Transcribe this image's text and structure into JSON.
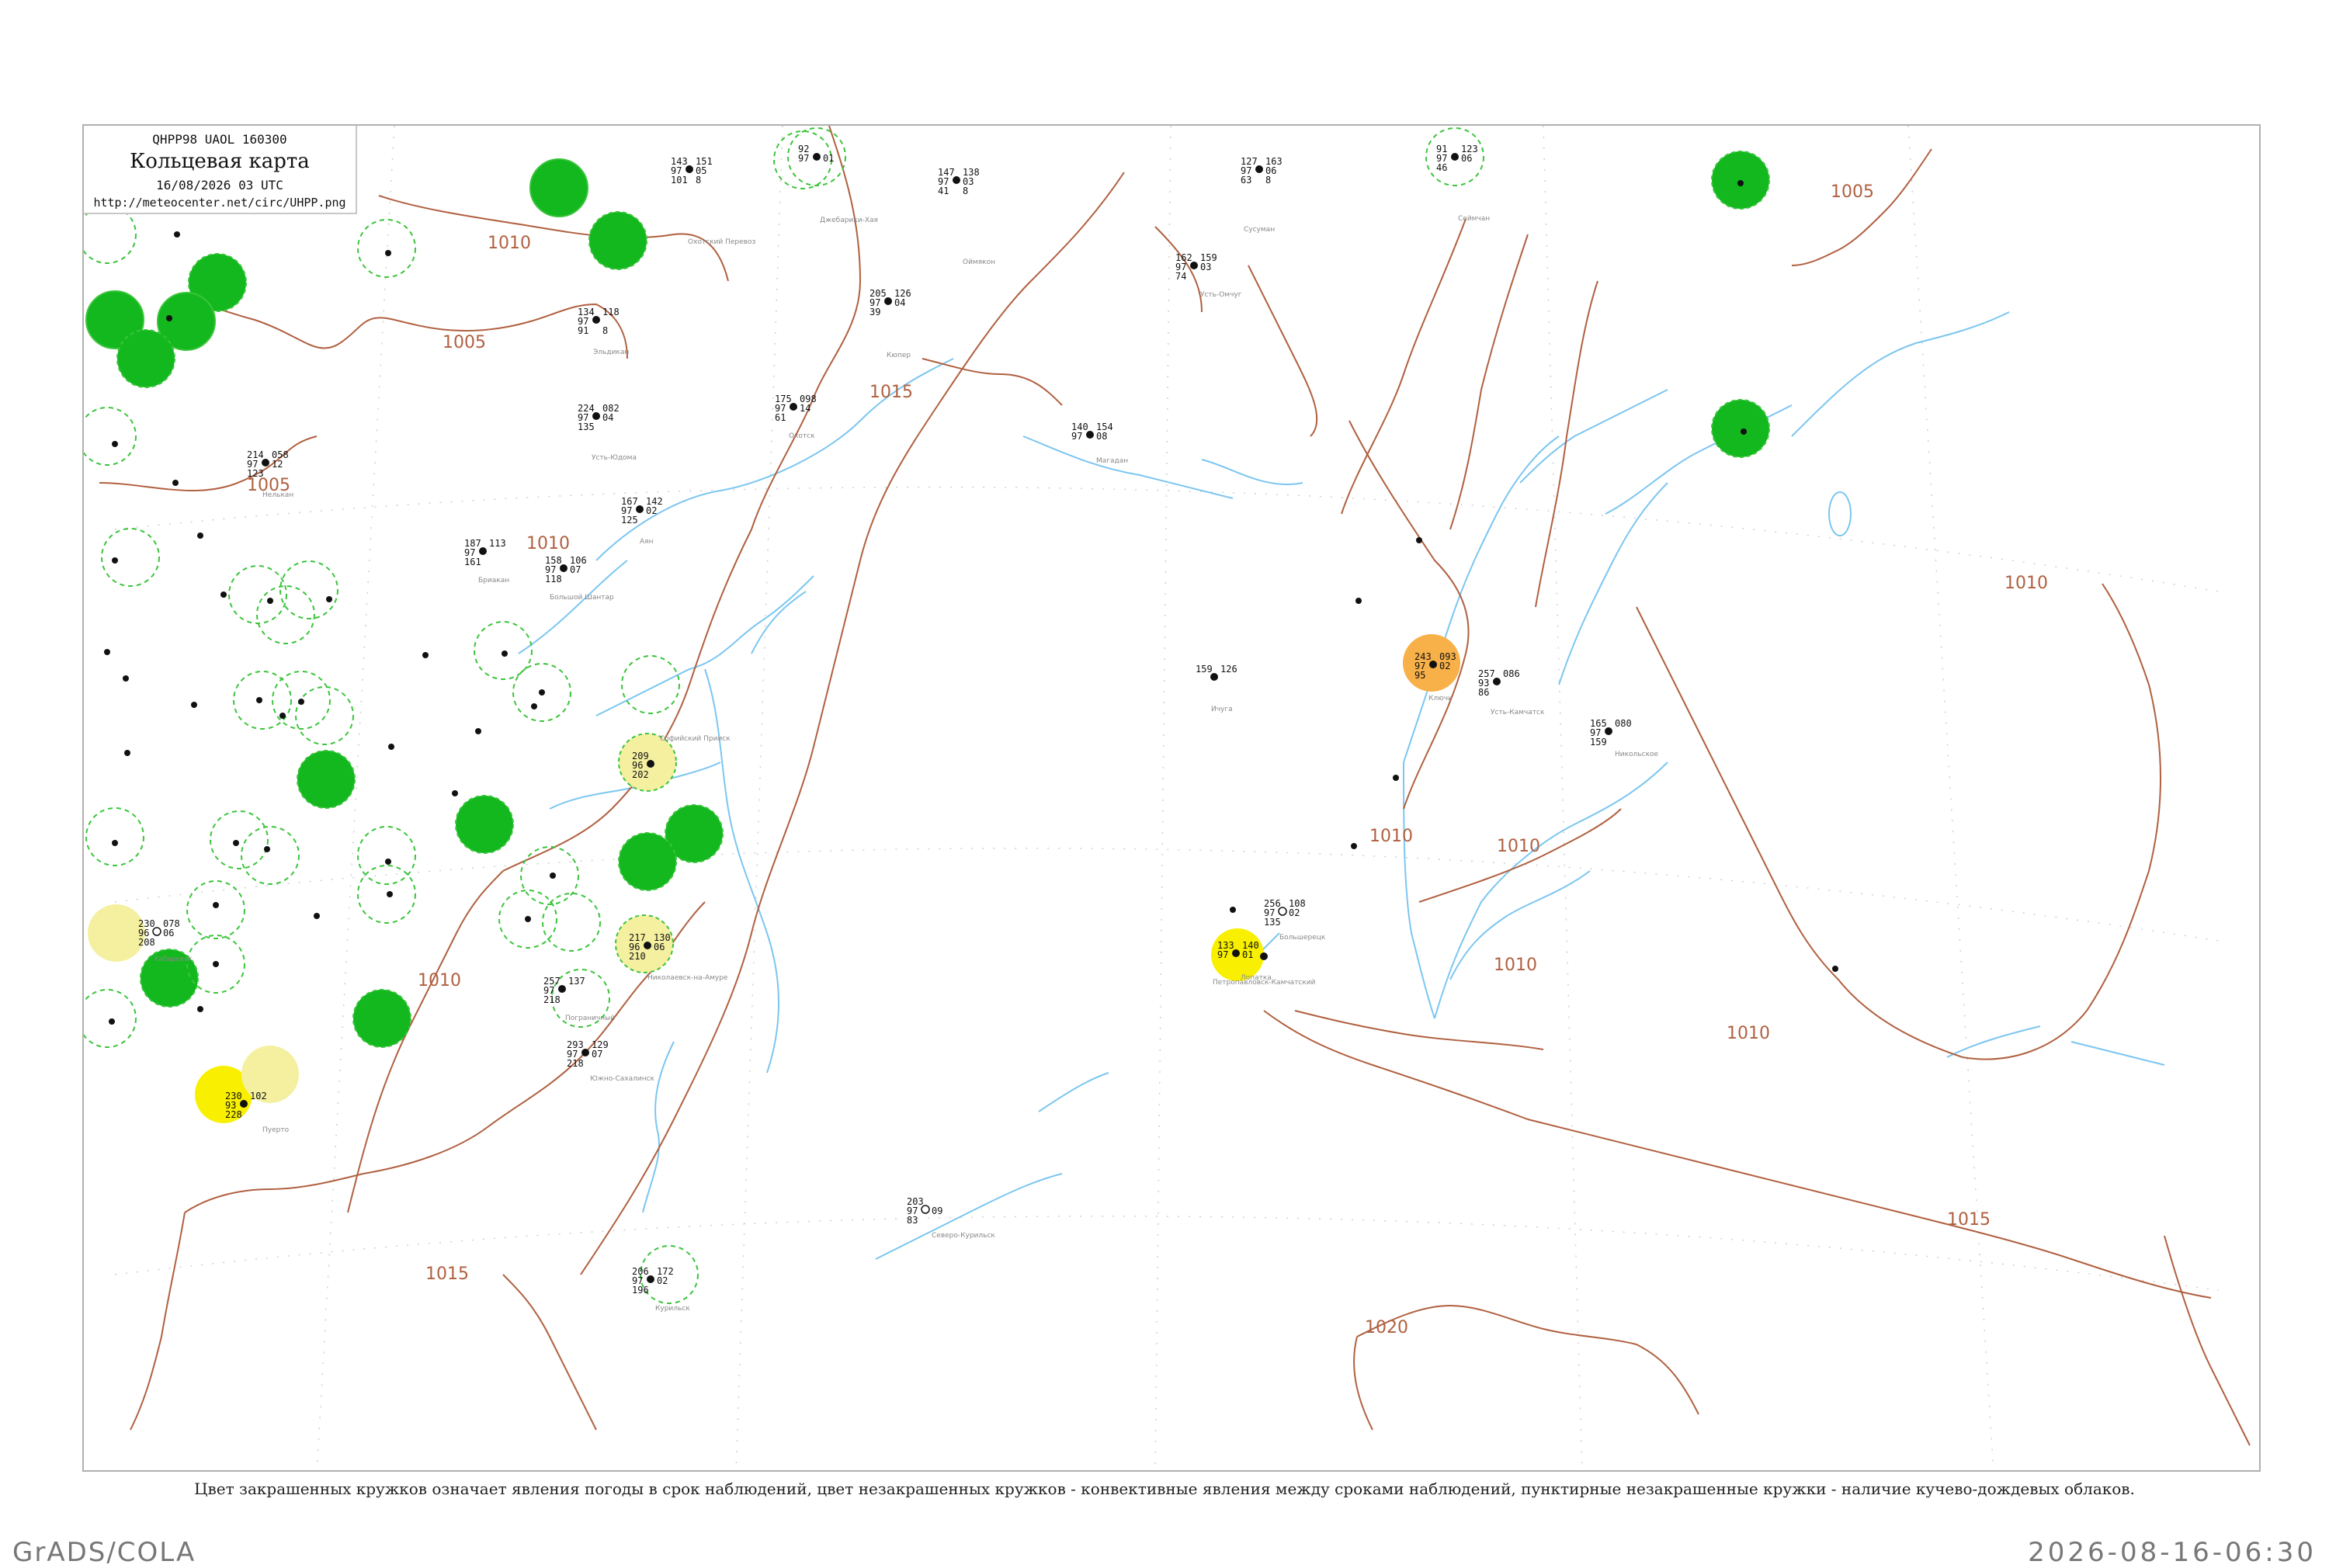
{
  "info": {
    "code": "QHPP98  UAOL  160300",
    "title": "Кольцевая карта",
    "date": "16/08/2026 03 UTC",
    "url": "http://meteocenter.net/circ/UHPP.png"
  },
  "caption": "Цвет закрашенных кружков означает явления погоды в срок наблюдений, цвет незакрашенных кружков - конвективные явления между сроками наблюдений, пунктирные незакрашенные кружки - наличие кучево-дождевых облаков.",
  "footer": {
    "left": "GrADS/COLA",
    "right": "2026-08-16-06:30"
  },
  "colors": {
    "isobar": "#b06040",
    "river": "#7cc6f0",
    "green_fill": "#12b81e",
    "green_dash": "#3cc43c",
    "yellow": "#f8f000",
    "pale_yellow": "#f4f0a0",
    "orange": "#f8b048"
  },
  "isobars": [
    {
      "value": "1010",
      "label": "1010"
    },
    {
      "value": "1005",
      "label": "1005"
    },
    {
      "value": "1005",
      "label": "1005"
    },
    {
      "value": "1010",
      "label": "1010"
    },
    {
      "value": "1015",
      "label": "1015"
    },
    {
      "value": "1010",
      "label": "1010"
    },
    {
      "value": "1015",
      "label": "1015"
    },
    {
      "value": "1010",
      "label": "1010"
    },
    {
      "value": "1010",
      "label": "1010"
    },
    {
      "value": "1005",
      "label": "1005"
    },
    {
      "value": "1010",
      "label": "1010"
    },
    {
      "value": "1010",
      "label": "1010"
    },
    {
      "value": "1010",
      "label": "1010"
    },
    {
      "value": "1020",
      "label": "1020"
    },
    {
      "value": "1015",
      "label": "1015"
    }
  ],
  "stations": [
    {
      "id": "s1",
      "name": "Охотский Перевоз",
      "index": "24871",
      "t": "143",
      "td": "97",
      "p": "151",
      "dp": "05",
      "v": "101",
      "w": "8",
      "marker": "none"
    },
    {
      "id": "s2",
      "name": "Джебарики-Хая",
      "index": "24879",
      "t": "92",
      "td": "97",
      "p": "",
      "dp": "01",
      "v": "",
      "w": "",
      "marker": "green-dash"
    },
    {
      "id": "s3",
      "name": "Оймякон",
      "index": "24688",
      "t": "147",
      "td": "97",
      "p": "138",
      "dp": "03",
      "v": "41",
      "w": "8",
      "marker": "none"
    },
    {
      "id": "s4",
      "name": "Сусуман",
      "index": "25206",
      "t": "127",
      "td": "97",
      "p": "163",
      "dp": "06",
      "v": "63",
      "w": "8",
      "marker": "none"
    },
    {
      "id": "s5",
      "name": "Сеймчан",
      "index": "25400",
      "t": "91",
      "td": "97",
      "p": "123",
      "dp": "06",
      "v": "46",
      "w": "",
      "marker": "green-dash"
    },
    {
      "id": "s6",
      "name": "Эльдикан",
      "index": "31004",
      "t": "134",
      "td": "97",
      "p": "118",
      "dp": "",
      "v": "91",
      "w": "8",
      "marker": "none"
    },
    {
      "id": "s7",
      "name": "Усть-Юдома",
      "index": "31062",
      "t": "224",
      "td": "97",
      "p": "082",
      "dp": "04",
      "v": "135",
      "w": "",
      "marker": "none"
    },
    {
      "id": "s8",
      "name": "Нелькан",
      "index": "31152",
      "t": "214",
      "td": "97",
      "p": "058",
      "dp": "12",
      "v": "123",
      "w": "",
      "marker": "none"
    },
    {
      "id": "s9",
      "name": "Аян",
      "index": "31168",
      "t": "167",
      "td": "97",
      "p": "142",
      "dp": "02",
      "v": "125",
      "w": "",
      "marker": "none"
    },
    {
      "id": "s10",
      "name": "Охотск",
      "index": "31088",
      "t": "175",
      "td": "97",
      "p": "098",
      "dp": "14",
      "v": "61",
      "w": "",
      "marker": "none"
    },
    {
      "id": "s11",
      "name": "Кюпер",
      "index": "24982",
      "t": "205",
      "td": "97",
      "p": "126",
      "dp": "04",
      "v": "39",
      "w": "",
      "marker": "none"
    },
    {
      "id": "s12",
      "name": "Усть-Омчуг",
      "index": "25703",
      "t": "162",
      "td": "97",
      "p": "159",
      "dp": "03",
      "v": "74",
      "w": "",
      "marker": "none"
    },
    {
      "id": "s13",
      "name": "Магадан",
      "index": "25913",
      "t": "140",
      "td": "97",
      "p": "154",
      "dp": "08",
      "v": "95",
      "w": "",
      "marker": "none"
    },
    {
      "id": "s14",
      "name": "Бриакан",
      "index": "31286",
      "t": "187",
      "td": "97",
      "p": "113",
      "dp": "",
      "v": "161",
      "w": "",
      "marker": "none"
    },
    {
      "id": "s15",
      "name": "Большой Шантар",
      "index": "31174",
      "t": "158",
      "td": "97",
      "p": "106",
      "dp": "07",
      "v": "118",
      "w": "",
      "marker": "none"
    },
    {
      "id": "s16",
      "name": "Усть-Камчатск",
      "index": "32389",
      "t": "257",
      "td": "93",
      "p": "086",
      "dp": "",
      "v": "86",
      "w": "",
      "marker": "none"
    },
    {
      "id": "s17",
      "name": "Ключи",
      "index": "32389",
      "t": "243",
      "td": "97",
      "p": "093",
      "dp": "02",
      "v": "95",
      "w": "",
      "marker": "orange"
    },
    {
      "id": "s18",
      "name": "Петропавловск-Камчатский",
      "index": "32540",
      "t": "133",
      "td": "97",
      "p": "140",
      "dp": "01",
      "v": "",
      "w": "",
      "marker": "yellow"
    },
    {
      "id": "s19",
      "name": "Никольское",
      "index": "32618",
      "t": "165",
      "td": "97",
      "p": "080",
      "dp": "",
      "v": "159",
      "w": "",
      "marker": "none"
    },
    {
      "id": "s20",
      "name": "Южно-Сахалинск",
      "index": "32150",
      "t": "293",
      "td": "97",
      "p": "129",
      "dp": "07",
      "v": "218",
      "w": "",
      "marker": "none"
    },
    {
      "id": "s21",
      "name": "Северо-Курильск",
      "index": "32213",
      "t": "203",
      "td": "97",
      "p": "",
      "dp": "09",
      "v": "83",
      "w": "",
      "marker": "none"
    },
    {
      "id": "s22",
      "name": "Ичуга",
      "index": "32098",
      "t": "159",
      "td": "97",
      "p": "126",
      "dp": "",
      "v": "",
      "w": "",
      "marker": "none"
    },
    {
      "id": "s23",
      "name": "Пограничный",
      "index": "31829",
      "t": "257",
      "td": "97",
      "p": "137",
      "dp": "",
      "v": "218",
      "w": "",
      "marker": "green-dash"
    },
    {
      "id": "s24",
      "name": "Курильск",
      "index": "32165",
      "t": "206",
      "td": "97",
      "p": "172",
      "dp": "02",
      "v": "196",
      "w": "",
      "marker": "green-dash"
    },
    {
      "id": "s25",
      "name": "Хабаровск",
      "index": "31735",
      "t": "230",
      "td": "96",
      "p": "078",
      "dp": "06",
      "v": "208",
      "w": "",
      "marker": "pale-yellow"
    },
    {
      "id": "s26",
      "name": "Пуерто",
      "index": "31939",
      "t": "230",
      "td": "93",
      "p": "102",
      "dp": "",
      "v": "228",
      "w": "",
      "marker": "yellow"
    },
    {
      "id": "s27",
      "name": "Софийский Прииск",
      "index": "31532",
      "t": "209",
      "td": "96",
      "p": "",
      "dp": "",
      "v": "202",
      "w": "",
      "marker": "pale-yellow"
    },
    {
      "id": "s28",
      "name": "Николаевск-на-Амуре",
      "index": "31369",
      "t": "217",
      "td": "96",
      "p": "130",
      "dp": "06",
      "v": "210",
      "w": "",
      "marker": "pale-yellow"
    },
    {
      "id": "s29",
      "name": "Большерецк",
      "index": "32564",
      "t": "256",
      "td": "97",
      "p": "108",
      "dp": "02",
      "v": "135",
      "w": "",
      "marker": "none"
    },
    {
      "id": "s30",
      "name": "Лопатка",
      "index": "32599",
      "t": "",
      "td": "",
      "p": "",
      "dp": "",
      "v": "",
      "w": "",
      "marker": "yellow"
    }
  ]
}
